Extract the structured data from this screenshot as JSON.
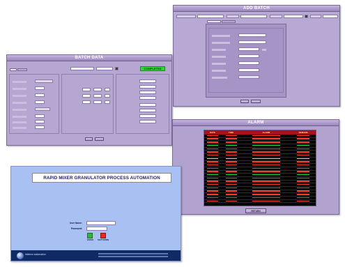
{
  "add_batch": {
    "title": "ADD BATCH",
    "top_fields": [
      "",
      "",
      "",
      "",
      ""
    ],
    "tabs": [
      "",
      ""
    ],
    "group_title": "",
    "rows": [
      {
        "label": "",
        "value": ""
      },
      {
        "label": "",
        "value": ""
      },
      {
        "label": "",
        "value": ""
      },
      {
        "label": "",
        "value": ""
      },
      {
        "label": "",
        "value": ""
      },
      {
        "label": "",
        "value": ""
      },
      {
        "label": "",
        "value": ""
      }
    ],
    "buttons": [
      "",
      ""
    ]
  },
  "batch_data": {
    "title": "BATCH DATA",
    "status": "COMPLETED",
    "buttons": [
      "",
      ""
    ]
  },
  "alarm": {
    "title": "ALARM",
    "columns": [
      "DATE",
      "TIME",
      "ALARM",
      "REMARK"
    ],
    "return_label": "RETURN",
    "colors": {
      "header_bg": "#a8121d",
      "header_text": "#ffe37a",
      "row_red": "#ff3b2a",
      "row_green": "#2fe04a",
      "row_yellow": "#ffe23a"
    },
    "row_colors": [
      "red",
      "red",
      "red",
      "green",
      "red",
      "red",
      "red",
      "yellow",
      "red",
      "red",
      "red",
      "red",
      "green",
      "red",
      "red",
      "red",
      "red",
      "red",
      "red",
      "red",
      "red"
    ]
  },
  "login": {
    "banner": "RAPID MIXER GRANULATOR  PROCESS AUTOMATION",
    "user_label": "User Name:",
    "password_label": "Password:",
    "enter_label": "ENTER",
    "shutdown_label": "SHUT DOWN",
    "company": "inteleon automation",
    "footer_text": ""
  }
}
